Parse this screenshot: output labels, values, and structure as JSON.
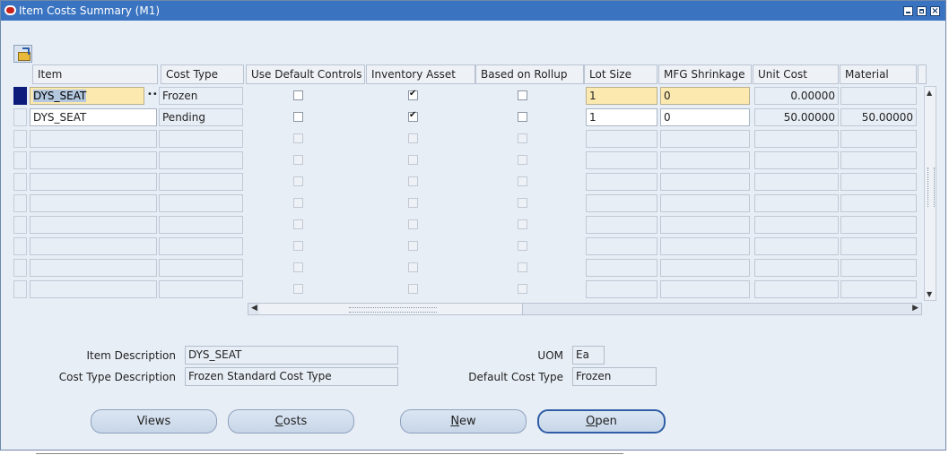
{
  "window": {
    "title": "Item Costs Summary (M1)"
  },
  "grid": {
    "headers": {
      "item": "Item",
      "cost_type": "Cost Type",
      "use_default_controls": "Use Default Controls",
      "inventory_asset": "Inventory Asset",
      "based_on_rollup": "Based on Rollup",
      "lot_size": "Lot Size",
      "mfg_shrinkage": "MFG Shrinkage",
      "unit_cost": "Unit Cost",
      "material": "Material"
    },
    "rows": [
      {
        "item": "DYS_SEAT",
        "cost_type": "Frozen",
        "use_default_controls": false,
        "inventory_asset": true,
        "based_on_rollup": false,
        "lot_size": "1",
        "mfg_shrinkage": "0",
        "unit_cost": "0.00000",
        "material": ""
      },
      {
        "item": "DYS_SEAT",
        "cost_type": "Pending",
        "use_default_controls": false,
        "inventory_asset": true,
        "based_on_rollup": false,
        "lot_size": "1",
        "mfg_shrinkage": "0",
        "unit_cost": "50.00000",
        "material": "50.00000"
      }
    ],
    "empty_row_count": 8
  },
  "details": {
    "item_description_label": "Item Description",
    "item_description": "DYS_SEAT",
    "cost_type_description_label": "Cost Type Description",
    "cost_type_description": "Frozen Standard Cost Type",
    "uom_label": "UOM",
    "uom": "Ea",
    "default_cost_type_label": "Default Cost Type",
    "default_cost_type": "Frozen"
  },
  "buttons": {
    "views": "Views",
    "costs_mnemonic": "C",
    "costs_rest": "osts",
    "new_mnemonic": "N",
    "new_rest": "ew",
    "open_mnemonic": "O",
    "open_rest": "pen"
  },
  "icons": {
    "title": "oracle-icon",
    "toolbar": "open-folder-icon"
  }
}
